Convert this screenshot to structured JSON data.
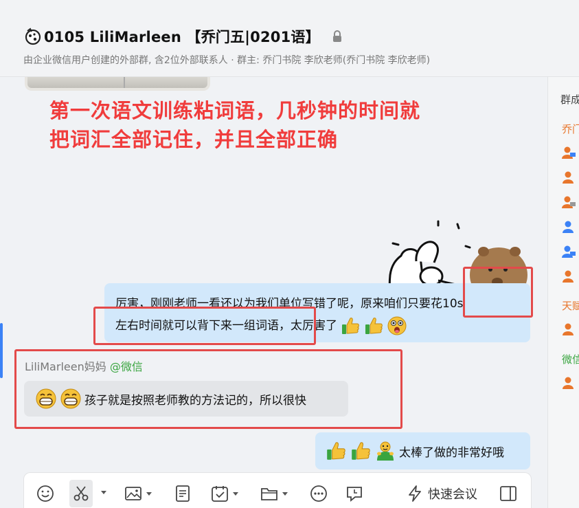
{
  "header": {
    "title": "0105  LiliMarleen 【乔门五|0201语】",
    "subtitle": "由企业微信用户创建的外部群, 含2位外部联系人 · 群主: 乔门书院 李欣老师(乔门书院 李欣老师)"
  },
  "side_panel": {
    "title": "群成",
    "labels": [
      {
        "text": "乔门",
        "color": "#e8762c"
      },
      {
        "text": "天赋",
        "color": "#e8762c"
      },
      {
        "text": "微信",
        "color": "#3aa540"
      }
    ]
  },
  "messages": {
    "image_caption": "第一次语文训练粘词语，几秒钟的时间就把词汇全部记住，并且全部正确",
    "sent_1": {
      "line1": "厉害，刚刚老师一看还以为我们单位写错了呢，原来咱们只要花10s",
      "line2": "左右时间就可以背下来一组词语，太厉害了"
    },
    "received_1": {
      "sender_name": "LiliMarleen妈妈",
      "sender_platform": "@微信",
      "text": "孩子就是按照老师教的方法记的，所以很快"
    },
    "sent_2": {
      "text": "太棒了做的非常好哦"
    }
  },
  "composer": {
    "tools": [
      "emoji-icon",
      "scissors-icon",
      "image-icon",
      "document-icon",
      "task-icon",
      "folder-icon",
      "more-icon",
      "schedule-icon"
    ],
    "meeting_label": "快速会议"
  },
  "colors": {
    "accent": "#3b82f6",
    "annotation_red": "#e34a4a",
    "caption_red": "#f03c3c",
    "sent_bubble": "#d2e8fb",
    "received_bubble": "#e3e5e8",
    "wechat_green": "#3aa540"
  }
}
